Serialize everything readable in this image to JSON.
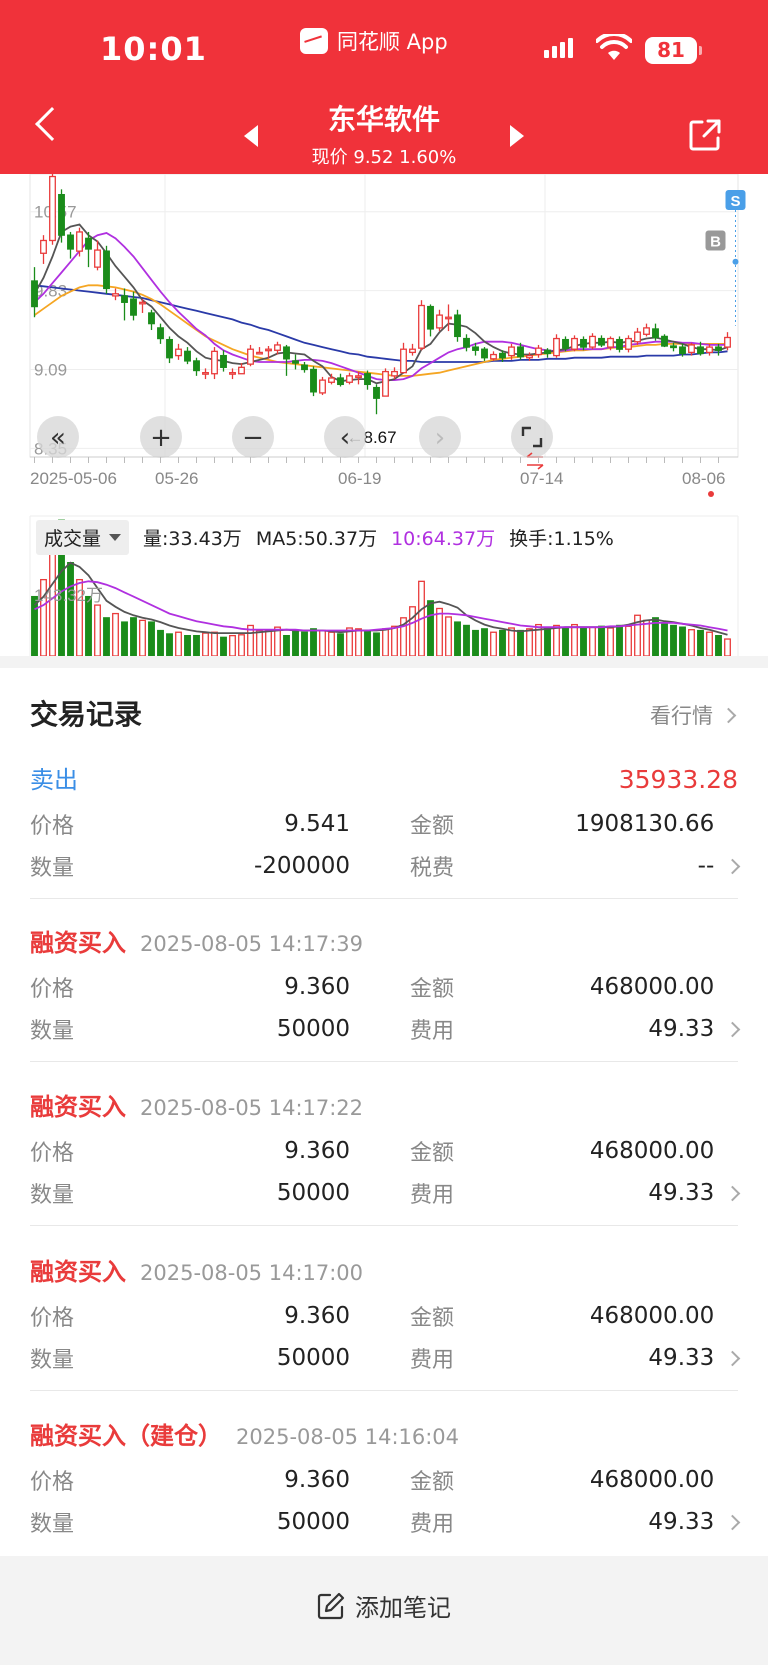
{
  "status_bar": {
    "time": "10:01",
    "app_name": "同花顺 App",
    "battery": "81"
  },
  "header": {
    "title": "东华软件",
    "subtitle": "现价 9.52 1.60%"
  },
  "chart_data": {
    "type": "candlestick",
    "y_ticks": [
      "10.57",
      "9.83",
      "9.09",
      "8.35"
    ],
    "x_ticks": [
      "2025-05-06",
      "05-26",
      "06-19",
      "07-14",
      "08-06"
    ],
    "low_marker": "←8.67",
    "buy_marker": "B",
    "sell_marker": "S",
    "colors": {
      "up": "#e93b3b",
      "down": "#1a8c1a",
      "ma5": "#555555",
      "ma10": "#b030e0",
      "ma20": "#f5a623",
      "ma60": "#2a3aa8"
    },
    "candles": [
      [
        9.92,
        9.68,
        9.58,
        10.05
      ],
      [
        10.18,
        10.3,
        10.08,
        10.35
      ],
      [
        10.3,
        10.9,
        10.26,
        10.98
      ],
      [
        10.73,
        10.35,
        10.28,
        10.78
      ],
      [
        10.35,
        10.22,
        10.13,
        10.38
      ],
      [
        10.2,
        10.38,
        10.15,
        10.42
      ],
      [
        10.32,
        10.22,
        10.05,
        10.38
      ],
      [
        10.05,
        10.21,
        10.02,
        10.3
      ],
      [
        10.2,
        9.85,
        9.8,
        10.25
      ],
      [
        9.78,
        9.8,
        9.74,
        9.85
      ],
      [
        9.78,
        9.72,
        9.55,
        9.85
      ],
      [
        9.75,
        9.6,
        9.55,
        9.82
      ],
      [
        9.72,
        9.72,
        9.62,
        9.75
      ],
      [
        9.62,
        9.52,
        9.46,
        9.65
      ],
      [
        9.48,
        9.38,
        9.33,
        9.52
      ],
      [
        9.37,
        9.2,
        9.15,
        9.4
      ],
      [
        9.22,
        9.28,
        9.18,
        9.33
      ],
      [
        9.26,
        9.17,
        9.14,
        9.3
      ],
      [
        9.17,
        9.08,
        9.03,
        9.2
      ],
      [
        9.05,
        9.06,
        9.0,
        9.1
      ],
      [
        9.05,
        9.26,
        9.0,
        9.3
      ],
      [
        9.22,
        9.11,
        9.07,
        9.27
      ],
      [
        9.06,
        9.06,
        9.0,
        9.1
      ],
      [
        9.05,
        9.11,
        9.05,
        9.15
      ],
      [
        9.14,
        9.28,
        9.12,
        9.32
      ],
      [
        9.25,
        9.25,
        9.23,
        9.3
      ],
      [
        9.28,
        9.28,
        9.19,
        9.31
      ],
      [
        9.27,
        9.32,
        9.23,
        9.35
      ],
      [
        9.3,
        9.19,
        9.03,
        9.32
      ],
      [
        9.17,
        9.15,
        9.09,
        9.23
      ],
      [
        9.13,
        9.09,
        9.06,
        9.16
      ],
      [
        9.09,
        8.88,
        8.84,
        9.12
      ],
      [
        8.87,
        8.99,
        8.85,
        9.02
      ],
      [
        8.97,
        9.01,
        8.95,
        9.05
      ],
      [
        9.01,
        8.95,
        8.93,
        9.05
      ],
      [
        8.97,
        9.03,
        8.95,
        9.06
      ],
      [
        9.03,
        9.03,
        8.95,
        9.07
      ],
      [
        9.05,
        8.95,
        8.9,
        9.08
      ],
      [
        8.92,
        8.82,
        8.67,
        8.95
      ],
      [
        8.84,
        9.07,
        8.84,
        9.1
      ],
      [
        9.03,
        9.07,
        9.0,
        9.11
      ],
      [
        9.06,
        9.28,
        9.06,
        9.34
      ],
      [
        9.25,
        9.28,
        9.22,
        9.33
      ],
      [
        9.29,
        9.69,
        9.27,
        9.74
      ],
      [
        9.68,
        9.47,
        9.4,
        9.7
      ],
      [
        9.48,
        9.6,
        9.45,
        9.65
      ],
      [
        9.58,
        9.58,
        9.45,
        9.7
      ],
      [
        9.6,
        9.4,
        9.35,
        9.65
      ],
      [
        9.38,
        9.3,
        9.26,
        9.42
      ],
      [
        9.3,
        9.27,
        9.22,
        9.34
      ],
      [
        9.28,
        9.2,
        9.17,
        9.3
      ],
      [
        9.19,
        9.23,
        9.17,
        9.26
      ],
      [
        9.24,
        9.2,
        9.16,
        9.27
      ],
      [
        9.22,
        9.3,
        9.18,
        9.33
      ],
      [
        9.3,
        9.21,
        9.18,
        9.34
      ],
      [
        9.2,
        9.22,
        9.17,
        9.25
      ],
      [
        9.23,
        9.29,
        9.2,
        9.32
      ],
      [
        9.27,
        9.24,
        9.2,
        9.29
      ],
      [
        9.22,
        9.38,
        9.2,
        9.42
      ],
      [
        9.37,
        9.29,
        9.26,
        9.4
      ],
      [
        9.28,
        9.38,
        9.26,
        9.41
      ],
      [
        9.37,
        9.3,
        9.27,
        9.4
      ],
      [
        9.3,
        9.4,
        9.28,
        9.43
      ],
      [
        9.38,
        9.32,
        9.3,
        9.41
      ],
      [
        9.3,
        9.38,
        9.27,
        9.4
      ],
      [
        9.37,
        9.28,
        9.25,
        9.4
      ],
      [
        9.28,
        9.38,
        9.25,
        9.41
      ],
      [
        9.35,
        9.44,
        9.32,
        9.48
      ],
      [
        9.42,
        9.48,
        9.4,
        9.52
      ],
      [
        9.47,
        9.39,
        9.36,
        9.52
      ],
      [
        9.4,
        9.31,
        9.3,
        9.42
      ],
      [
        9.31,
        9.3,
        9.26,
        9.34
      ],
      [
        9.3,
        9.24,
        9.21,
        9.33
      ],
      [
        9.25,
        9.32,
        9.22,
        9.34
      ],
      [
        9.3,
        9.24,
        9.22,
        9.35
      ],
      [
        9.25,
        9.3,
        9.22,
        9.33
      ],
      [
        9.3,
        9.27,
        9.22,
        9.33
      ],
      [
        9.3,
        9.39,
        9.27,
        9.44
      ]
    ],
    "ma5": [
      9.8,
      9.95,
      10.15,
      10.38,
      10.43,
      10.45,
      10.35,
      10.29,
      10.18,
      10.06,
      9.96,
      9.86,
      9.74,
      9.68,
      9.58,
      9.48,
      9.4,
      9.34,
      9.26,
      9.2,
      9.18,
      9.17,
      9.15,
      9.14,
      9.16,
      9.18,
      9.2,
      9.24,
      9.25,
      9.24,
      9.23,
      9.17,
      9.12,
      9.02,
      8.98,
      8.99,
      9.0,
      9.0,
      8.96,
      8.98,
      9.0,
      9.06,
      9.12,
      9.28,
      9.33,
      9.44,
      9.52,
      9.51,
      9.49,
      9.43,
      9.35,
      9.3,
      9.26,
      9.24,
      9.23,
      9.23,
      9.24,
      9.25,
      9.27,
      9.28,
      9.31,
      9.33,
      9.34,
      9.34,
      9.35,
      9.34,
      9.35,
      9.36,
      9.38,
      9.39,
      9.37,
      9.35,
      9.33,
      9.3,
      9.28,
      9.28,
      9.27,
      9.3
    ],
    "ma10": [
      9.72,
      9.8,
      9.9,
      10.0,
      10.1,
      10.2,
      10.3,
      10.35,
      10.37,
      10.32,
      10.24,
      10.15,
      10.04,
      9.93,
      9.82,
      9.72,
      9.63,
      9.55,
      9.47,
      9.41,
      9.33,
      9.27,
      9.23,
      9.2,
      9.17,
      9.16,
      9.16,
      9.16,
      9.16,
      9.17,
      9.18,
      9.18,
      9.17,
      9.15,
      9.12,
      9.09,
      9.06,
      9.03,
      9.0,
      8.99,
      8.99,
      9.0,
      9.03,
      9.1,
      9.15,
      9.2,
      9.25,
      9.28,
      9.3,
      9.33,
      9.35,
      9.35,
      9.35,
      9.34,
      9.32,
      9.3,
      9.28,
      9.27,
      9.26,
      9.27,
      9.28,
      9.28,
      9.28,
      9.28,
      9.3,
      9.3,
      9.32,
      9.33,
      9.34,
      9.35,
      9.35,
      9.35,
      9.34,
      9.34,
      9.33,
      9.32,
      9.32,
      9.32
    ],
    "ma20": [
      9.6,
      9.66,
      9.72,
      9.78,
      9.82,
      9.86,
      9.88,
      9.88,
      9.87,
      9.86,
      9.84,
      9.82,
      9.79,
      9.75,
      9.7,
      9.64,
      9.58,
      9.52,
      9.46,
      9.4,
      9.36,
      9.32,
      9.28,
      9.25,
      9.22,
      9.2,
      9.18,
      9.16,
      9.15,
      9.14,
      9.13,
      9.12,
      9.11,
      9.1,
      9.09,
      9.08,
      9.07,
      9.06,
      9.05,
      9.04,
      9.03,
      9.03,
      9.03,
      9.04,
      9.05,
      9.06,
      9.08,
      9.1,
      9.12,
      9.14,
      9.16,
      9.18,
      9.19,
      9.2,
      9.21,
      9.22,
      9.23,
      9.24,
      9.25,
      9.26,
      9.27,
      9.27,
      9.28,
      9.28,
      9.29,
      9.3,
      9.3,
      9.31,
      9.32,
      9.32,
      9.33,
      9.33,
      9.33,
      9.33,
      9.33,
      9.33,
      9.33,
      9.33
    ],
    "ma60": [
      9.88,
      9.87,
      9.86,
      9.85,
      9.84,
      9.83,
      9.82,
      9.81,
      9.8,
      9.79,
      9.78,
      9.77,
      9.76,
      9.74,
      9.72,
      9.7,
      9.68,
      9.66,
      9.64,
      9.62,
      9.6,
      9.58,
      9.56,
      9.53,
      9.51,
      9.48,
      9.46,
      9.43,
      9.4,
      9.37,
      9.34,
      9.32,
      9.3,
      9.28,
      9.26,
      9.24,
      9.23,
      9.21,
      9.2,
      9.19,
      9.18,
      9.17,
      9.17,
      9.16,
      9.16,
      9.16,
      9.16,
      9.16,
      9.16,
      9.16,
      9.16,
      9.17,
      9.17,
      9.17,
      9.18,
      9.18,
      9.18,
      9.19,
      9.19,
      9.19,
      9.2,
      9.2,
      9.2,
      9.2,
      9.21,
      9.21,
      9.21,
      9.21,
      9.22,
      9.22,
      9.22,
      9.22,
      9.23,
      9.23,
      9.24,
      9.25,
      9.25,
      9.26
    ],
    "volume": {
      "button_label": "成交量",
      "vol_text": "量:33.43万",
      "ma5_text": "MA5:50.37万",
      "ma10_text": "10:64.37万",
      "turnover_text": "换手:1.15%",
      "y_tick": "143.32万",
      "values": [
        70,
        90,
        130,
        160,
        110,
        90,
        70,
        60,
        45,
        50,
        40,
        45,
        42,
        40,
        30,
        26,
        28,
        24,
        24,
        27,
        28,
        22,
        24,
        25,
        36,
        30,
        30,
        34,
        24,
        30,
        28,
        32,
        30,
        28,
        26,
        33,
        32,
        30,
        27,
        32,
        35,
        45,
        58,
        88,
        65,
        56,
        46,
        40,
        36,
        30,
        32,
        28,
        30,
        33,
        30,
        32,
        37,
        34,
        36,
        33,
        37,
        33,
        34,
        35,
        33,
        36,
        35,
        48,
        42,
        45,
        38,
        36,
        34,
        31,
        30,
        28,
        24,
        20
      ],
      "ma5": [
        60,
        70,
        85,
        100,
        110,
        105,
        95,
        80,
        65,
        58,
        52,
        48,
        45,
        43,
        40,
        36,
        33,
        31,
        29,
        28,
        27,
        27,
        27,
        27,
        27,
        28,
        29,
        30,
        31,
        30,
        30,
        30,
        30,
        29,
        28,
        29,
        30,
        30,
        30,
        31,
        33,
        37,
        45,
        55,
        62,
        64,
        61,
        57,
        48,
        42,
        37,
        34,
        32,
        30,
        29,
        30,
        31,
        32,
        33,
        34,
        34,
        34,
        34,
        34,
        34,
        35,
        37,
        40,
        42,
        43,
        41,
        40,
        38,
        36,
        33,
        31,
        28,
        25
      ],
      "ma10": [
        55,
        60,
        68,
        76,
        82,
        86,
        88,
        87,
        84,
        80,
        75,
        70,
        65,
        60,
        55,
        50,
        47,
        44,
        41,
        39,
        37,
        35,
        34,
        32,
        31,
        31,
        31,
        31,
        31,
        31,
        30,
        30,
        30,
        30,
        30,
        30,
        30,
        30,
        31,
        32,
        33,
        35,
        39,
        44,
        48,
        50,
        50,
        49,
        48,
        46,
        44,
        42,
        40,
        38,
        36,
        35,
        34,
        34,
        34,
        34,
        34,
        34,
        34,
        34,
        35,
        35,
        36,
        37,
        38,
        39,
        39,
        39,
        38,
        37,
        36,
        34,
        32,
        30
      ]
    }
  },
  "chart_controls": {
    "btn_prev_period": "«",
    "btn_zoom_in": "+",
    "btn_zoom_out": "−",
    "btn_left": "‹",
    "btn_right": "›"
  },
  "records": {
    "title": "交易记录",
    "more_link": "看行情",
    "entries": [
      {
        "type": "卖出",
        "timestamp": "",
        "amount": "35933.28",
        "price_label": "价格",
        "price": "9.541",
        "total_label": "金额",
        "total": "1908130.66",
        "qty_label": "数量",
        "qty": "-200000",
        "fee_label": "税费",
        "fee": "--"
      },
      {
        "type": "融资买入",
        "timestamp": "2025-08-05 14:17:39",
        "amount": "",
        "price_label": "价格",
        "price": "9.360",
        "total_label": "金额",
        "total": "468000.00",
        "qty_label": "数量",
        "qty": "50000",
        "fee_label": "费用",
        "fee": "49.33"
      },
      {
        "type": "融资买入",
        "timestamp": "2025-08-05 14:17:22",
        "amount": "",
        "price_label": "价格",
        "price": "9.360",
        "total_label": "金额",
        "total": "468000.00",
        "qty_label": "数量",
        "qty": "50000",
        "fee_label": "费用",
        "fee": "49.33"
      },
      {
        "type": "融资买入",
        "timestamp": "2025-08-05 14:17:00",
        "amount": "",
        "price_label": "价格",
        "price": "9.360",
        "total_label": "金额",
        "total": "468000.00",
        "qty_label": "数量",
        "qty": "50000",
        "fee_label": "费用",
        "fee": "49.33"
      },
      {
        "type": "融资买入（建仓）",
        "timestamp": "2025-08-05 14:16:04",
        "amount": "",
        "price_label": "价格",
        "price": "9.360",
        "total_label": "金额",
        "total": "468000.00",
        "qty_label": "数量",
        "qty": "50000",
        "fee_label": "费用",
        "fee": "49.33"
      }
    ]
  },
  "footer": {
    "add_note": "添加笔记"
  }
}
